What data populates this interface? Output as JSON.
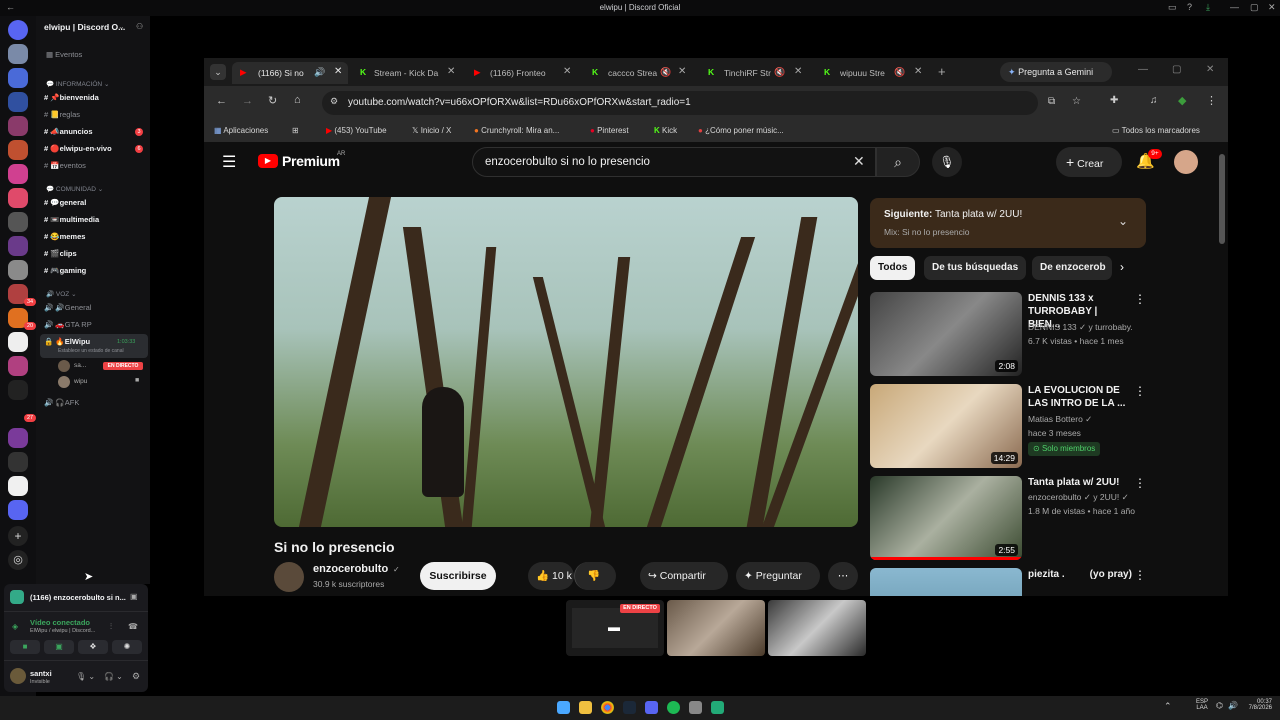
{
  "window": {
    "title": "elwipu | Discord Oficial"
  },
  "discord": {
    "server_name": "elwipu | Discord O...",
    "events": "Eventos",
    "categories": {
      "info": "INFORMACIÓN",
      "comunidad": "COMUNIDAD",
      "voz": "VOZ"
    },
    "channels_info": [
      "bienvenida",
      "reglas",
      "anuncios",
      "elwipu-en-vivo",
      "eventos"
    ],
    "badges": {
      "anuncios": "3",
      "en_vivo": "6"
    },
    "channels_comunidad": [
      "general",
      "multimedia",
      "memes",
      "clips",
      "gaming"
    ],
    "voice": {
      "general": "General",
      "gta": "GTA RP",
      "elwipu": "ElWipu",
      "elwipu_time": "1:03:33",
      "elwipu_status": "Establece un estado de canal",
      "member1": "sa...",
      "member1_badge": "EN DIRECTO",
      "member2": "wipu",
      "afk": "AFK"
    },
    "guild_badges": [
      "34",
      "20",
      "27"
    ],
    "activity": "(1166) enzocerobulto si n...",
    "video_connected": "Vídeo conectado",
    "video_sub": "ElWipu / elwipu | Discord...",
    "user": {
      "name": "santxi",
      "status": "Invisible"
    }
  },
  "browser": {
    "tabs": [
      {
        "label": "(1166) Si no"
      },
      {
        "label": "Stream - Kick Da"
      },
      {
        "label": "(1166) Fronteo"
      },
      {
        "label": "caccco Strea"
      },
      {
        "label": "TinchiRF Str"
      },
      {
        "label": "wipuuu Stre"
      }
    ],
    "gemini": "Pregunta a Gemini",
    "url": "youtube.com/watch?v=u66xOPfORXw&list=RDu66xOPfORXw&start_radio=1",
    "bookmarks": [
      "Aplicaciones",
      "(453) YouTube",
      "Inicio / X",
      "Crunchyroll: Mira an...",
      "Pinterest",
      "Kick",
      "¿Cómo poner músic..."
    ],
    "all_bookmarks": "Todos los marcadores"
  },
  "youtube": {
    "logo": "Premium",
    "logo_region": "AR",
    "search": "enzocerobulto si no lo presencio",
    "create": "Crear",
    "notif_count": "9+",
    "video_title": "Si no lo presencio",
    "channel": "enzocerobulto",
    "subscribers": "30.9 k suscriptores",
    "subscribe": "Suscribirse",
    "likes": "10 k",
    "share": "Compartir",
    "ask": "Preguntar",
    "next_label": "Siguiente:",
    "next_title": "Tanta plata w/ 2UU!",
    "mix": "Mix: Si no lo presencio",
    "chips": [
      "Todos",
      "De tus búsquedas",
      "De enzocerob"
    ],
    "recs": [
      {
        "title": "DENNIS 133 x TURROBABY | BIEN...",
        "channel": "DENNIS 133 ✓ y turrobaby.",
        "meta": "6.7 K vistas • hace 1 mes",
        "duration": "2:08"
      },
      {
        "title": "LA EVOLUCION DE LAS INTRO DE LA ...",
        "channel": "Matias Bottero ✓",
        "meta": "hace 3 meses",
        "badge": "Solo miembros",
        "duration": "14:29"
      },
      {
        "title": "Tanta plata w/ 2UU!",
        "channel": "enzocerobulto ✓ y 2UU! ✓",
        "meta": "1.8 M de vistas • hace 1 año",
        "duration": "2:55"
      },
      {
        "title": "piezita .         (yo pray)",
        "channel": "",
        "meta": "",
        "duration": ""
      }
    ]
  },
  "stream_preview": {
    "live": "EN DIRECTO"
  },
  "taskbar": {
    "lang": "ESP",
    "lang2": "LAA",
    "time": "00:37",
    "date": "7/8/2026"
  }
}
